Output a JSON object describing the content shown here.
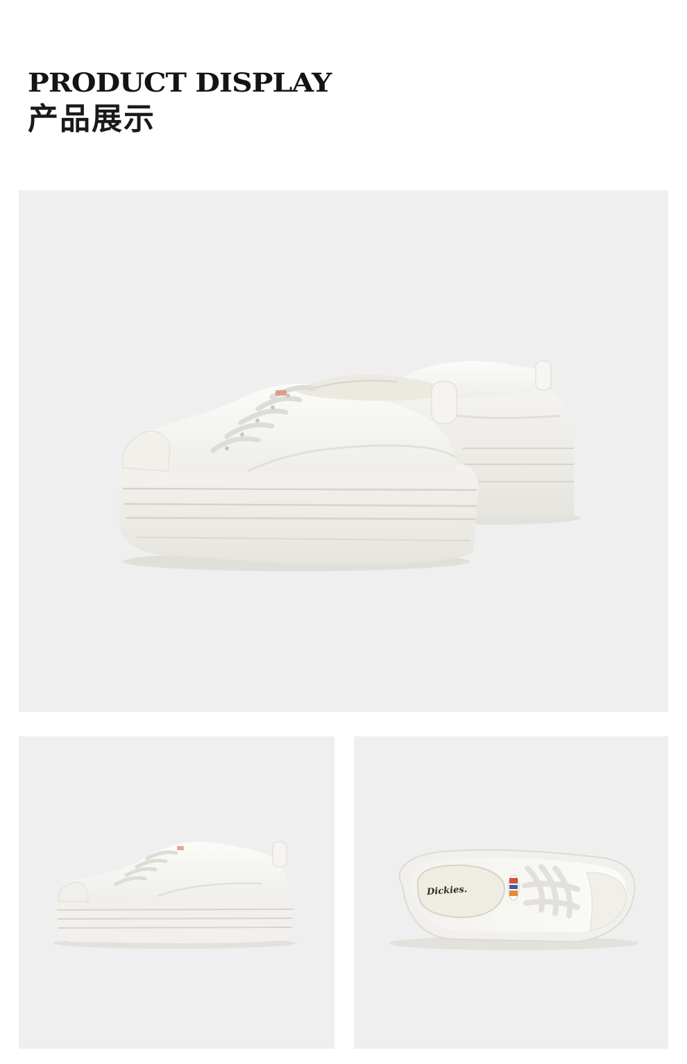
{
  "header": {
    "title_en": "PRODUCT DISPLAY",
    "title_cn": "产品展示"
  },
  "photos": [
    {
      "icon": "sneaker-pair-photo"
    },
    {
      "icon": "sneaker-side-view-photo"
    },
    {
      "icon": "sneaker-top-view-photo",
      "insole_text": "Dickies."
    }
  ],
  "colors": {
    "background": "#ffffff",
    "panel": "#efefef",
    "shoe": "#f7f6f2",
    "sole": "#eeece7",
    "title": "#141414"
  }
}
